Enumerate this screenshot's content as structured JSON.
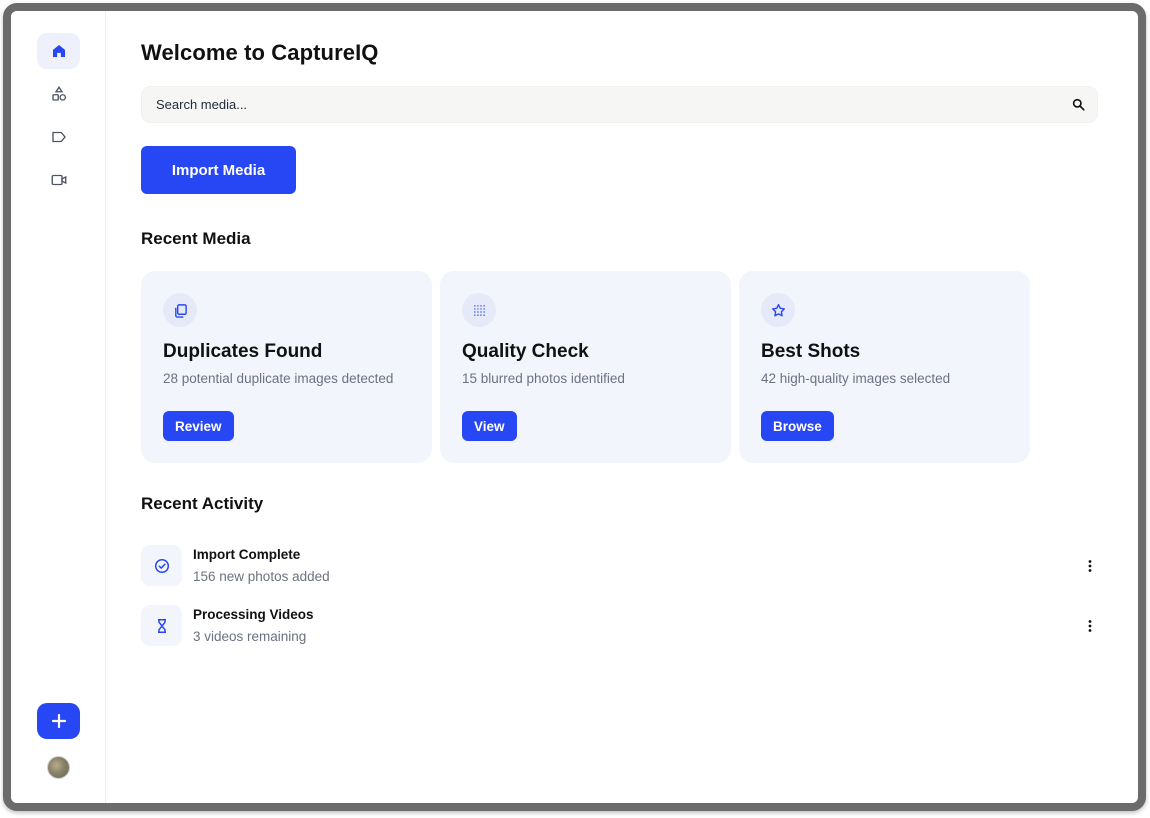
{
  "app": {
    "title": "Welcome to CaptureIQ"
  },
  "search": {
    "placeholder": "Search media..."
  },
  "actions": {
    "import_label": "Import Media"
  },
  "sidebar": {
    "items": [
      {
        "name": "home",
        "icon": "home-icon",
        "active": true
      },
      {
        "name": "shapes",
        "icon": "shapes-icon",
        "active": false
      },
      {
        "name": "labels",
        "icon": "tag-icon",
        "active": false
      },
      {
        "name": "videos",
        "icon": "video-icon",
        "active": false
      }
    ],
    "add_icon": "plus-icon"
  },
  "recent_media": {
    "heading": "Recent Media",
    "cards": [
      {
        "icon": "duplicate-icon",
        "title": "Duplicates Found",
        "description": "28 potential duplicate images detected",
        "button": "Review"
      },
      {
        "icon": "grid-dots-icon",
        "title": "Quality Check",
        "description": "15 blurred photos identified",
        "button": "View"
      },
      {
        "icon": "star-icon",
        "title": "Best Shots",
        "description": "42 high-quality images selected",
        "button": "Browse"
      }
    ]
  },
  "recent_activity": {
    "heading": "Recent Activity",
    "items": [
      {
        "icon": "check-circle-icon",
        "title": "Import Complete",
        "subtitle": "156 new photos added"
      },
      {
        "icon": "hourglass-icon",
        "title": "Processing Videos",
        "subtitle": "3 videos remaining"
      }
    ]
  },
  "colors": {
    "accent": "#2747f5",
    "card_bg": "#f3f5fd",
    "muted_text": "#6b7280"
  }
}
